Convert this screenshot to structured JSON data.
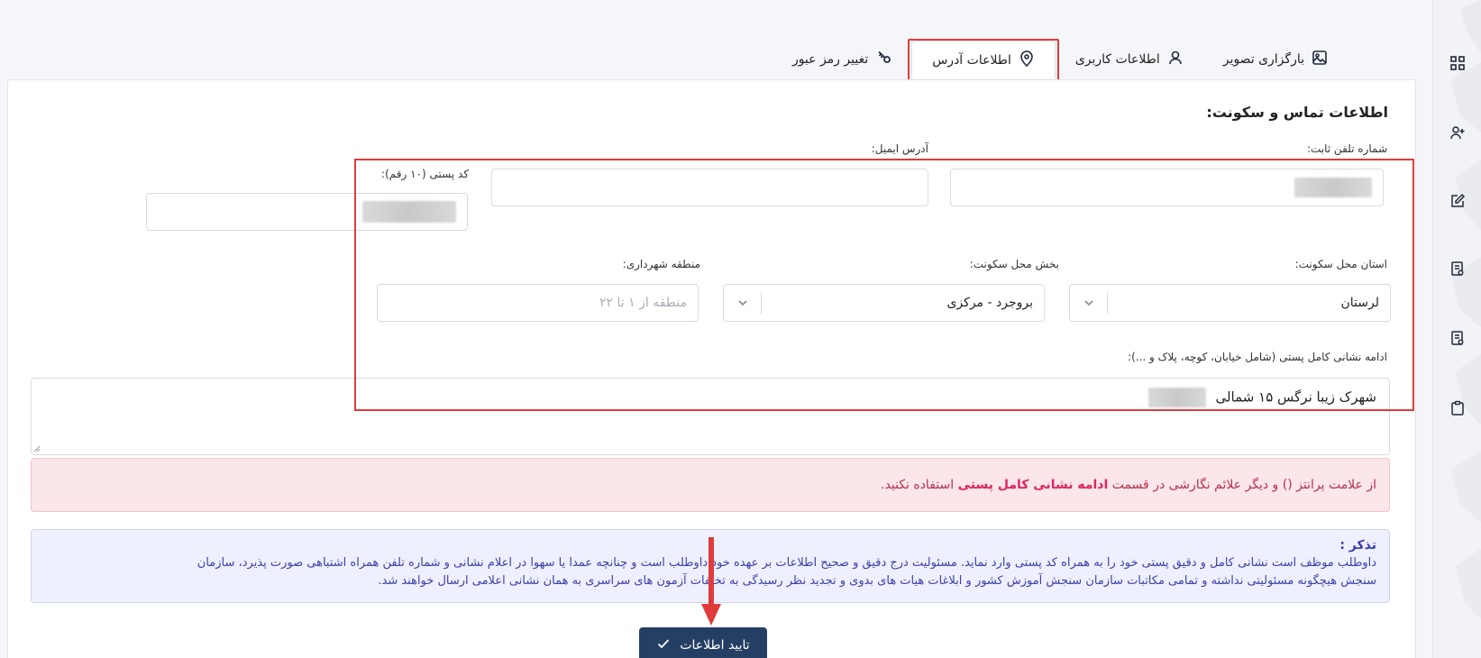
{
  "tabs": [
    {
      "label": "بارگزاری تصویر",
      "icon": "image-icon"
    },
    {
      "label": "اطلاعات کاربری",
      "icon": "user-icon"
    },
    {
      "label": "اطلاعات آدرس",
      "icon": "location-pin-icon",
      "active": true
    },
    {
      "label": "تغییر رمز عبور",
      "icon": "key-icon"
    }
  ],
  "section_title": "اطلاعات تماس و سکونت:",
  "form": {
    "landline_label": "شماره تلفن ثابت:",
    "email_label": "آدرس ایمیل:",
    "postal_code_label": "کد پستی (۱۰ رقم):",
    "province_label": "استان محل سکونت:",
    "province_value": "لرستان",
    "district_label": "بخش محل سکونت:",
    "district_value": "بروجرد - مرکزی",
    "municipality_label": "منطقه شهرداری:",
    "municipality_placeholder": "منطقه از ۱ تا ۲۲",
    "address_label": "ادامه نشانی کامل پستی (شامل خیابان، کوچه، پلاک و ...):",
    "address_value": "شهرک زیبا نرگس ۱۵ شمالی"
  },
  "alert_danger": {
    "prefix": "از علامت پرانتز () و دیگر علائم نگارشی در قسمت",
    "bold": "ادامه نشانی کامل پستی",
    "suffix": "استفاده نکنید."
  },
  "alert_info": {
    "title": "تذکر :",
    "line1": "داوطلب موظف است نشانی کامل و دقیق پستی خود را به همراه کد پستی وارد نماید. مسئولیت درج دقیق و صحیح اطلاعات بر عهده خود داوطلب است و چنانچه عمدا یا سهوا در اعلام نشانی و شماره تلفن همراه اشتباهی صورت پذیرد، سازمان",
    "line2": "سنجش هیچگونه مسئولیتی نداشته و تمامی مکاتبات سازمان سنجش آموزش کشور و ابلاغات هیات های بدوی و تجدید نظر رسیدگی به تخلفات آزمون های سراسری به همان نشانی اعلامی ارسال خواهند شد."
  },
  "submit_label": "تایید اطلاعات",
  "sidebar_icons": [
    "dashboard-grid-icon",
    "add-user-icon",
    "edit-icon",
    "document-check-icon",
    "document-check-icon",
    "clipboard-icon"
  ],
  "colors": {
    "highlight": "#e03b3b",
    "primary": "#253f64",
    "danger_bg": "#fbe6ea",
    "info_bg": "#eef0ff"
  }
}
